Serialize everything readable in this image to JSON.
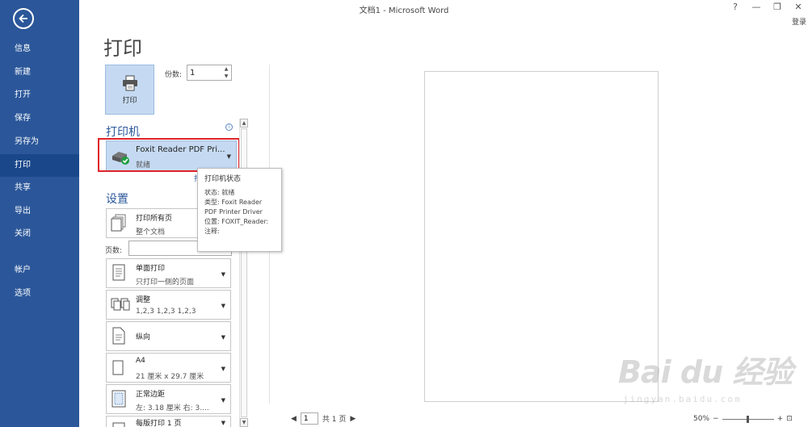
{
  "window": {
    "title": "文档1 - Microsoft Word",
    "help": "?",
    "minimize": "—",
    "restore": "❐",
    "close": "✕",
    "login": "登录"
  },
  "nav": {
    "items": [
      {
        "label": "信息"
      },
      {
        "label": "新建"
      },
      {
        "label": "打开"
      },
      {
        "label": "保存"
      },
      {
        "label": "另存为"
      },
      {
        "label": "打印",
        "active": true
      },
      {
        "label": "共享"
      },
      {
        "label": "导出"
      },
      {
        "label": "关闭"
      },
      {
        "label": "帐户"
      },
      {
        "label": "选项"
      }
    ],
    "bg_color": "#2b579a",
    "active_color": "#19478a"
  },
  "main": {
    "heading": "打印",
    "print_button": "打印",
    "copies_label": "份数:",
    "copies_value": "1"
  },
  "printer": {
    "section_title": "打印机",
    "name": "Foxit Reader PDF Pri...",
    "status": "就绪",
    "properties_link": "打",
    "tooltip": {
      "title": "打印机状态",
      "lines": [
        "状态: 就绪",
        "类型: Foxit Reader",
        "PDF Printer Driver",
        "位置: FOXIT_Reader:",
        "注释:"
      ]
    }
  },
  "settings": {
    "section_title": "设置",
    "pages_label": "页数:",
    "items": [
      {
        "main": "打印所有页",
        "sub": "整个文档"
      },
      {
        "main": "单面打印",
        "sub": "只打印一侧的页面"
      },
      {
        "main": "调整",
        "sub": "1,2,3    1,2,3    1,2,3"
      },
      {
        "main": "纵向",
        "sub": ""
      },
      {
        "main": "A4",
        "sub": "21 厘米 x 29.7 厘米"
      },
      {
        "main": "正常边距",
        "sub": "左: 3.18 厘米    右: 3...."
      },
      {
        "main": "每版打印 1 页",
        "sub": ""
      }
    ]
  },
  "footer": {
    "page_value": "1",
    "page_total": "共 1 页",
    "zoom": "50%"
  },
  "watermark": {
    "text": "Bai du 经验",
    "url": "jingyan.baidu.com"
  }
}
